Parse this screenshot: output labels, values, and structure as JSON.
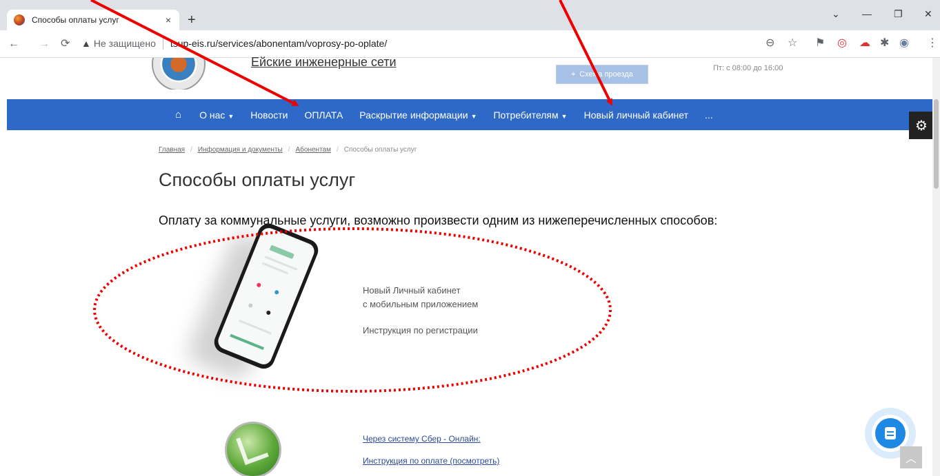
{
  "browser": {
    "tab_title": "Способы оплаты услуг",
    "tab_close": "×",
    "new_tab": "+",
    "security_label": "Не защищено",
    "url": "tsup-eis.ru/services/abonentam/voprosy-po-oplate/",
    "window_controls": [
      "⌄",
      "—",
      "❐",
      "✕"
    ]
  },
  "header": {
    "site_name": "Ейские инженерные сети",
    "map_button": "Схема проезда",
    "hours": "Пт: с 08:00 до 16:00"
  },
  "nav": {
    "home_icon": "home-icon",
    "items": [
      {
        "label": "О нас",
        "dropdown": true
      },
      {
        "label": "Новости",
        "dropdown": false
      },
      {
        "label": "ОПЛАТА",
        "dropdown": false
      },
      {
        "label": "Раскрытие информации",
        "dropdown": true
      },
      {
        "label": "Потребителям",
        "dropdown": true
      },
      {
        "label": "Новый личный кабинет",
        "dropdown": false
      },
      {
        "label": "...",
        "dropdown": false
      }
    ]
  },
  "breadcrumb": [
    "Главная",
    "Информация и документы",
    "Абонентам",
    "Способы оплаты услуг"
  ],
  "page": {
    "title": "Способы оплаты услуг",
    "intro": "Оплату за коммунальные услуги, возможно произвести одним из нижеперечисленных способов:"
  },
  "method_cabinet": {
    "line1": "Новый Личный кабинет",
    "line2": "с мобильным приложением",
    "instruction": "Инструкция по регистрации"
  },
  "method_sber": {
    "link1": "Через систему Сбер - Онлайн:",
    "link2": "Инструкция по оплате (посмотреть)"
  },
  "colors": {
    "navbar": "#2f69c8",
    "annotation": "#ee0000",
    "chat": "#1e88e5"
  }
}
